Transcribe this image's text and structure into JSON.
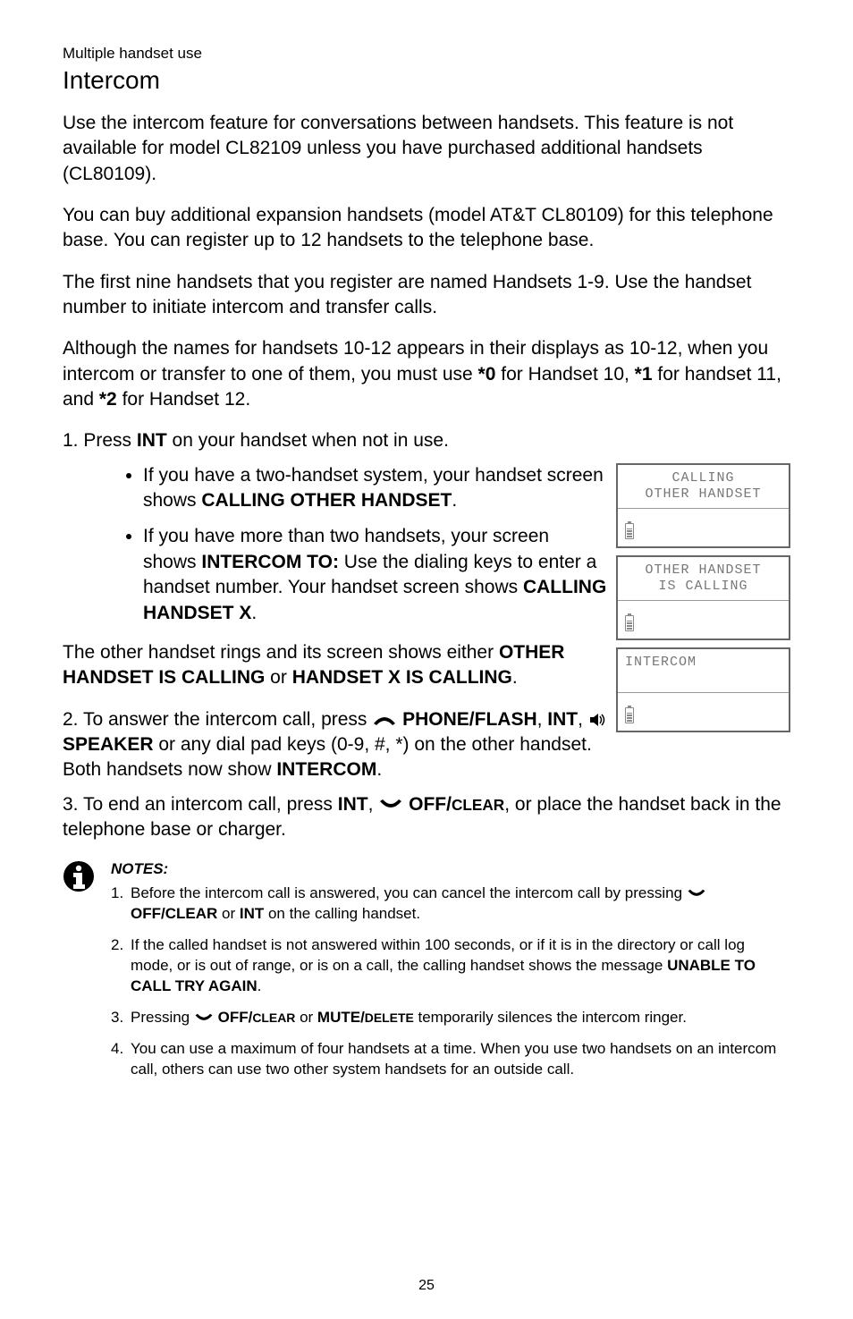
{
  "header": {
    "category": "Multiple handset use",
    "title": "Intercom"
  },
  "paragraphs": {
    "p1": "Use the intercom feature for conversations between handsets. This feature is not available for model CL82109 unless you have purchased additional handsets (CL80109).",
    "p2": "You can buy additional expansion handsets (model AT&T CL80109) for this telephone base. You can register up to 12 handsets to the telephone base.",
    "p3": "The first nine handsets that you register are named Handsets 1-9. Use the handset number to initiate intercom and transfer calls.",
    "p4_a": "Although the names for handsets 10-12 appears in their displays as 10-12, when you intercom or transfer to one of them, you must use ",
    "p4_b": "*0",
    "p4_c": " for Handset 10, ",
    "p4_d": "*1",
    "p4_e": " for handset 11, and ",
    "p4_f": "*2",
    "p4_g": " for Handset 12."
  },
  "steps": {
    "s1_a": "1. Press ",
    "s1_b": "INT",
    "s1_c": " on your handset when not in use.",
    "b1_a": "If you have a two-handset system, your handset screen shows ",
    "b1_b": "CALLING OTHER HANDSET",
    "b1_c": ".",
    "b2_a": "If you have more than two handsets, your screen shows ",
    "b2_b": "INTERCOM TO:",
    "b2_c": " Use the dialing keys to enter a handset number. Your handset screen shows ",
    "b2_d": "CALLING HANDSET X",
    "b2_e": ".",
    "mid_a": "The other handset rings and its screen shows either ",
    "mid_b": "OTHER HANDSET IS CALLING",
    "mid_c": " or ",
    "mid_d": "HANDSET X IS CALLING",
    "mid_e": ".",
    "s2_a": "2. To answer the intercom call, press ",
    "s2_b": "PHONE/FLASH",
    "s2_c": ", ",
    "s2_d": "INT",
    "s2_e": ", ",
    "s2_f": "SPEAKER",
    "s2_g": " or any dial pad keys (0-9, #, *) on the other handset. Both handsets now show ",
    "s2_h": "INTERCOM",
    "s2_i": ".",
    "s3_a": "3. To end an intercom call, press ",
    "s3_b": "INT",
    "s3_c": ", ",
    "s3_d": "OFF/",
    "s3_d2": "CLEAR",
    "s3_e": ", or place the handset back in the telephone base or charger."
  },
  "lcd": {
    "panel1_l1": "CALLING",
    "panel1_l2": "OTHER HANDSET",
    "panel2_l1": "OTHER HANDSET",
    "panel2_l2": "IS CALLING",
    "panel3_l1": "INTERCOM"
  },
  "notes": {
    "heading": "NOTES:",
    "n1_a": "Before the intercom call is answered, you can cancel the intercom call by pressing ",
    "n1_b": "OFF/CLEAR",
    "n1_c": " or ",
    "n1_d": "INT",
    "n1_e": " on the calling handset.",
    "n2_a": "If the called handset is not answered within 100 seconds, or if it is in the directory or call log mode, or is out of range, or is on a call, the calling handset shows the message ",
    "n2_b": "UNABLE TO CALL TRY AGAIN",
    "n2_c": ".",
    "n3_a": "Pressing ",
    "n3_b": "OFF/",
    "n3_b2": "CLEAR",
    "n3_c": " or ",
    "n3_d": "MUTE/",
    "n3_d2": "DELETE",
    "n3_e": " temporarily silences the intercom ringer.",
    "n4": "You can use a maximum of four handsets at a time. When you use two handsets on an intercom call, others can use two other system handsets for an outside call."
  },
  "page_number": "25"
}
